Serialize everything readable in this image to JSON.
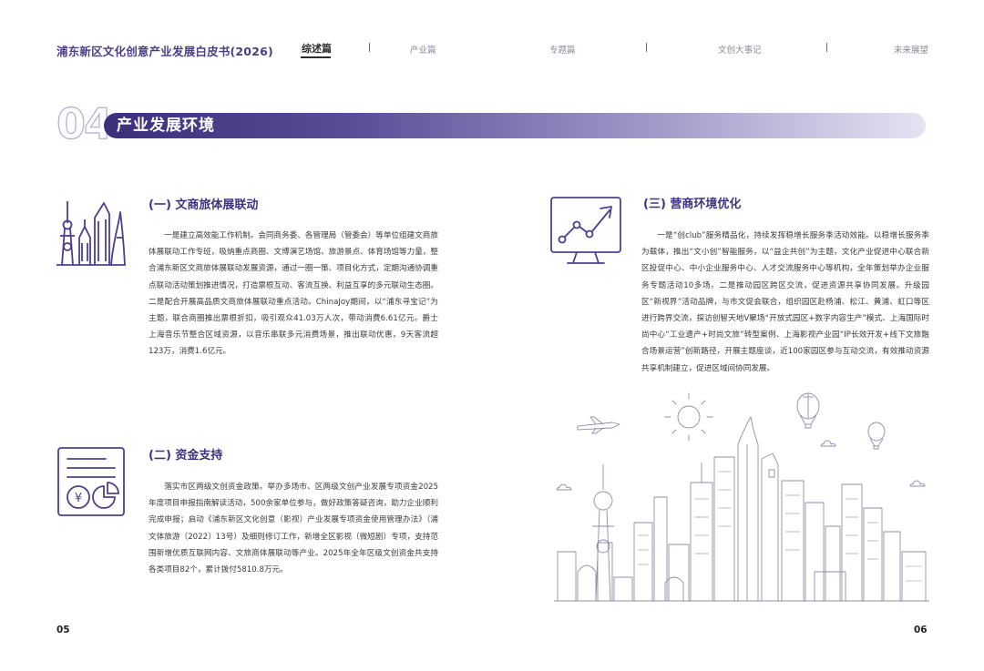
{
  "header": {
    "doc_title": "浦东新区文化创意产业发展白皮书(2026)",
    "nav": [
      "综述篇",
      "产业篇",
      "专题篇",
      "文创大事记",
      "未来展望"
    ],
    "active_tab": "综述篇"
  },
  "section": {
    "number": "04",
    "title": "产业发展环境"
  },
  "sub1": {
    "title": "(一) 文商旅体展联动",
    "icon": "city-skyline-icon",
    "text": "一是建立高效能工作机制。会同商务委、各管理局（管委会）等单位组建文商旅体展联动工作专班，吸纳重点商圈、文博演艺场馆、旅游景点、体育场馆等力量，整合浦东新区文商旅体展联动发展资源，通过一圈一策、项目化方式，定期沟通协调重点联动活动策划推进情况，打造票根互动、客流互换、利益互享的多元联动生态圈。二是配合开展高品质文商旅体展联动重点活动。ChinaJoy期间，以“浦东寻宝记”为主题，联合商圈推出票根折扣，吸引观众41.03万人次，带动消费6.61亿元。爵士上海音乐节整合区域资源，以音乐串联多元消费场景，推出联动优惠，9天客流超123万，消费1.6亿元。"
  },
  "sub2": {
    "title": "(二) 资金支持",
    "icon": "funding-document-icon",
    "text": "落实市区两级文创资金政策。举办多场市、区两级文创产业发展专项资金2025年度项目申报指南解读活动，500余家单位参与，做好政策答疑咨询，助力企业顺利完成申报；启动《浦东新区文化创意（影视）产业发展专项资金使用管理办法》（浦文体旅游〔2022〕13号）及细则修订工作，新增全区影视（微短剧）专项，支持范围新增优质互联网内容、文旅商体展联动等产业。2025年全年区级文创资金共支持各类项目82个，累计拨付5810.8万元。"
  },
  "sub3": {
    "title": "(三) 营商环境优化",
    "icon": "growth-chart-icon",
    "text": "一是“创club”服务精品化，持续发挥稳增长服务季活动效能。以稳增长服务季为载体，推出“文小创”智能服务，以“益企共创”为主题，文化产业促进中心联合新区投促中心、中小企业服务中心、人才交流服务中心等机构，全年策划举办企业服务专题活动10多场。二是推动园区跨区交流，促进资源共享协同发展。升级园区“新视界”活动品牌，与市文促会联合，组织园区赴杨浦、松江、黄浦、虹口等区进行跨界交流，探访创智天地V聚场“开放式园区+数字内容生产”模式、上海国际时尚中心“工业遗产+时尚文旅”转型案例、上海影视产业园“IP长效开发+线下文旅融合场景运营”创新路径，开展主题座谈，近100家园区参与互动交流，有效推动资源共享机制建立，促进区域间协同发展。"
  },
  "illustration": "city-skyline-illustration",
  "footer": {
    "left_page": "05",
    "right_page": "06"
  },
  "colors": {
    "accent": "#3c3280",
    "banner_start": "#3b2f7a",
    "banner_end": "#e6e3f2",
    "line_art": "#4b4090"
  }
}
